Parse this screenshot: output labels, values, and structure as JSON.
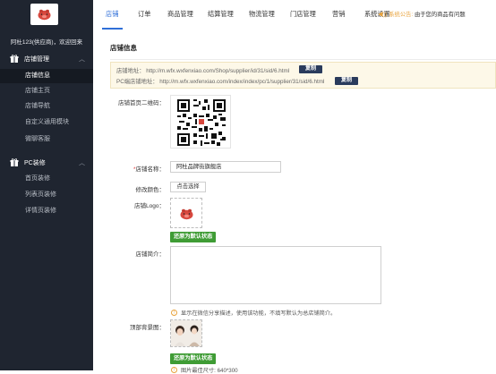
{
  "sidebar": {
    "welcome": "阿杜123(供应商)，欢迎回来",
    "sections": [
      {
        "label": "店铺管理",
        "icon": "gift-icon",
        "expanded": true
      },
      {
        "label": "PC装修",
        "icon": "gift-icon",
        "expanded": true
      }
    ],
    "store_items": [
      "店铺信息",
      "店铺主页",
      "店铺导航",
      "自定义通用模块",
      "微聊客服"
    ],
    "pc_items": [
      "首页装修",
      "列表页装修",
      "详情页装修"
    ]
  },
  "topnav": {
    "items": [
      "店铺",
      "订单",
      "商品管理",
      "结算管理",
      "物流管理",
      "门店管理",
      "营销",
      "系统设置"
    ],
    "active": "店铺",
    "notice_label": "系统公告:",
    "notice_text": "由于您的商品有问题"
  },
  "page": {
    "title": "店铺信息",
    "shop_url_label": "店铺地址：",
    "shop_url": "http://m.wfx.wxfenxiao.com/Shop/supplier/id/31/sid/6.html",
    "pc_url_label": "PC端店铺地址：",
    "pc_url": "http://m.wfx.wxfenxiao.com/index/index/pc/1/supplier/31/sid/6.html",
    "copy_label": "复制",
    "qr_label": "店铺首页二维码：",
    "name_label": "店铺名称：",
    "name_value": "阿杜品牌街旗舰店",
    "color_label": "修改颜色：",
    "color_button": "点击选择",
    "logo_label": "店铺Logo：",
    "reset_label": "还原为默认状态",
    "intro_label": "店铺简介：",
    "intro_value": "",
    "intro_hint": "显示在微信分享描述，使用该功能，不填写默认为总店铺简介。",
    "bg_label": "顶部背景图：",
    "bg_hint": "图片最佳尺寸: 640*300"
  },
  "colors": {
    "sidebar_bg": "#1f2530",
    "active_nav": "#2f6fd8",
    "copy_button": "#2a3b5c",
    "reset_button": "#3f9c35",
    "notice_icon": "#e8a33d",
    "required": "#e23b3b"
  }
}
